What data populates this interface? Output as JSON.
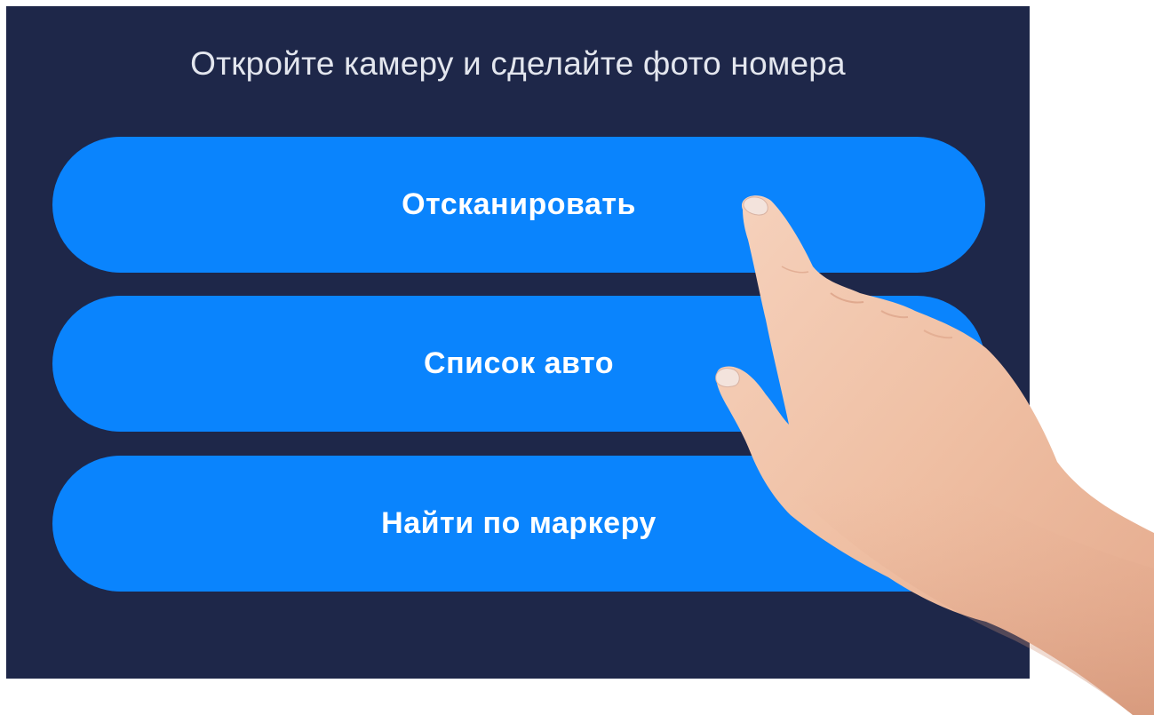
{
  "screen": {
    "prompt": "Откройте камеру и сделайте фото номера",
    "background_color": "#1e2749",
    "accent_color": "#0a84fd"
  },
  "buttons": [
    {
      "label": "Отсканировать"
    },
    {
      "label": "Список авто"
    },
    {
      "label": "Найти по маркеру"
    }
  ],
  "overlay": {
    "icon": "pointing-hand-icon"
  }
}
